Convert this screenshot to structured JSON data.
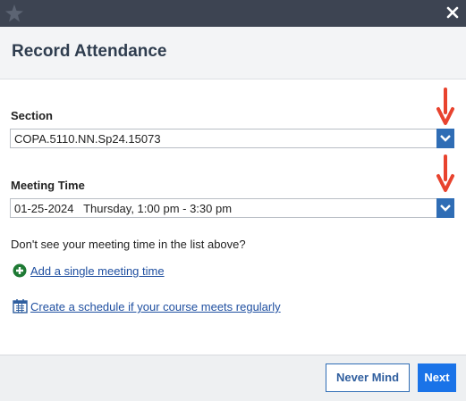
{
  "dialog": {
    "title": "Record Attendance",
    "close_icon": "close-icon",
    "logo_icon": "star-logo-icon"
  },
  "section": {
    "label": "Section",
    "selected": "COPA.5110.NN.Sp24.15073"
  },
  "meeting_time": {
    "label": "Meeting Time",
    "selected": "01-25-2024   Thursday, 1:00 pm - 3:30 pm"
  },
  "help": {
    "hint": "Don't see your meeting time in the list above?",
    "add_single_label": "Add a single meeting time",
    "create_schedule_label": "Create a schedule if your course meets regularly"
  },
  "footer": {
    "never_mind_label": "Never Mind",
    "next_label": "Next"
  },
  "colors": {
    "titlebar": "#3d4452",
    "accent": "#1a73e8",
    "annotation_arrow": "#e8432e",
    "add_icon": "#1e7a34"
  }
}
